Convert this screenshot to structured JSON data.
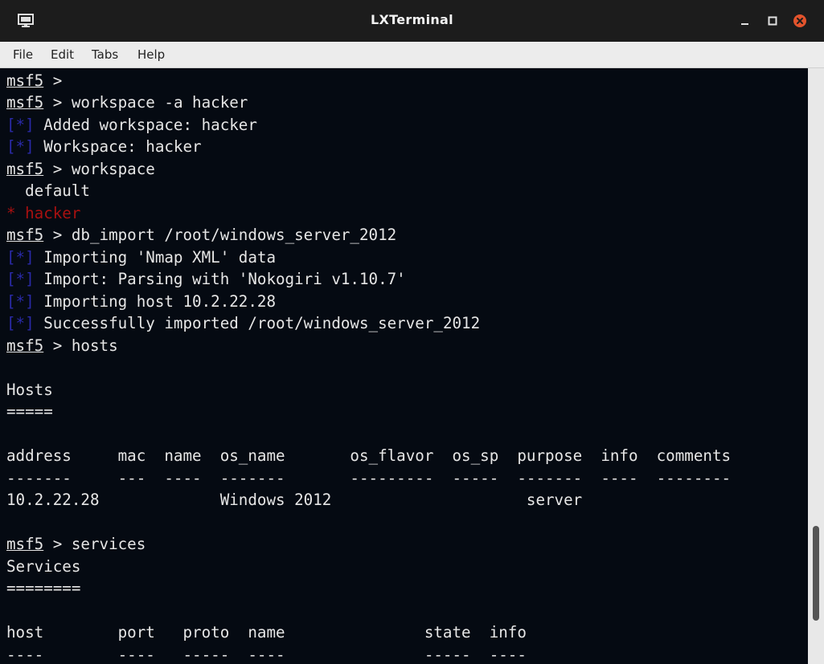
{
  "window": {
    "title": "LXTerminal",
    "accent_close": "#e2532c"
  },
  "menu": {
    "items": [
      "File",
      "Edit",
      "Tabs",
      "Help"
    ]
  },
  "terminal": {
    "prompt": "msf5",
    "info_mark": "[*]",
    "lines": {
      "l0_cmd": " >",
      "l1_cmd": " > workspace -a hacker",
      "l2_text": " Added workspace: hacker",
      "l3_text": " Workspace: hacker",
      "l4_cmd": " > workspace",
      "l5_text": "  default",
      "l6_text": "* hacker",
      "l7_cmd": " > db_import /root/windows_server_2012",
      "l8_text": " Importing 'Nmap XML' data",
      "l9_text": " Import: Parsing with 'Nokogiri v1.10.7'",
      "l10_text": " Importing host 10.2.22.28",
      "l11_text": " Successfully imported /root/windows_server_2012",
      "l12_cmd": " > hosts",
      "l14_text": "Hosts",
      "l15_text": "=====",
      "l17_text": "address     mac  name  os_name       os_flavor  os_sp  purpose  info  comments",
      "l18_text": "-------     ---  ----  -------       ---------  -----  -------  ----  --------",
      "l19_text": "10.2.22.28             Windows 2012                     server",
      "l21_cmd": " > services",
      "l22_text": "Services",
      "l23_text": "========",
      "l25_text": "host        port   proto  name               state  info",
      "l26_text": "----        ----   -----  ----               -----  ----"
    }
  }
}
